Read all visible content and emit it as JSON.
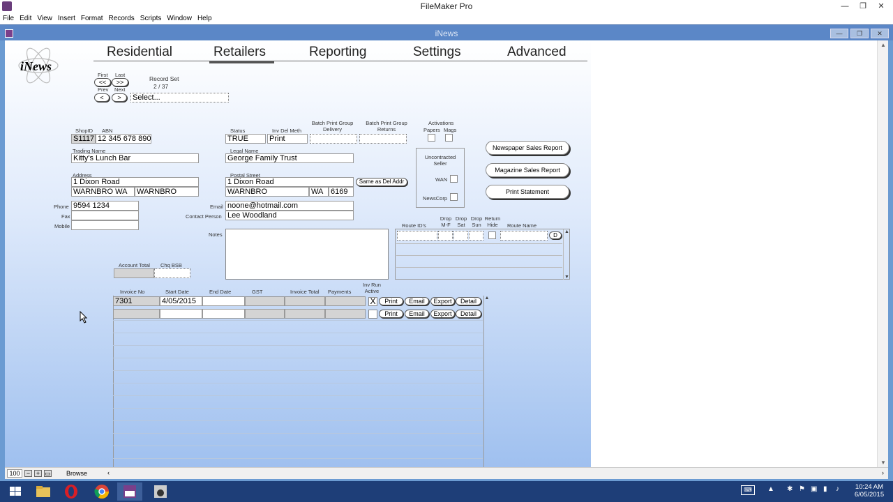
{
  "app": {
    "title": "FileMaker Pro",
    "doc_title": "iNews"
  },
  "menu": [
    "File",
    "Edit",
    "View",
    "Insert",
    "Format",
    "Records",
    "Scripts",
    "Window",
    "Help"
  ],
  "logo": "iNews",
  "nav_tabs": [
    "Residential",
    "Retailers",
    "Reporting",
    "Settings",
    "Advanced"
  ],
  "record_nav": {
    "first": "First",
    "last": "Last",
    "prev": "Prev",
    "next": "Next",
    "first_btn": "<<",
    "last_btn": ">>",
    "prev_btn": "<",
    "next_btn": ">",
    "record_set_label": "Record Set",
    "record_count": "2 / 37",
    "select_value": "Select..."
  },
  "labels": {
    "shopid": "ShopID",
    "abn": "ABN",
    "status": "Status",
    "inv_del_meth": "Inv Del Meth",
    "batch_delivery": "Batch Print Group Delivery",
    "batch_returns": "Batch Print Group Returns",
    "activations": "Activations",
    "papers": "Papers",
    "mags": "Mags",
    "trading_name": "Trading Name",
    "legal_name": "Legal Name",
    "address": "Address",
    "postal_street": "Postal Street",
    "phone": "Phone",
    "fax": "Fax",
    "mobile": "Mobile",
    "email": "Email",
    "contact_person": "Contact Person",
    "notes": "Notes",
    "account_total": "Account Total",
    "chq_bsb": "Chq BSB",
    "uncontracted": "Uncontracted Seller",
    "wan": "WAN",
    "newscorp": "NewsCorp",
    "route_ids": "Route ID's",
    "drop_mf": "Drop M-F",
    "drop_sat": "Drop Sat",
    "drop_sun": "Drop Sun",
    "return_hide": "Return Hide",
    "route_name": "Route Name"
  },
  "fields": {
    "shopid": "S1117",
    "abn": "12 345 678 890",
    "status": "TRUE",
    "inv_del_meth": "Print",
    "trading_name": "Kitty's Lunch Bar",
    "legal_name": "George Family Trust",
    "address1": "1 Dixon Road",
    "address_suburb": "WARNBRO WA",
    "address_town": "WARNBRO",
    "postal1": "1 Dixon Road",
    "postal_suburb": "WARNBRO",
    "postal_state": "WA",
    "postal_pc": "6169",
    "phone": "9594 1234",
    "email": "noone@hotmail.com",
    "contact_person": "Lee Woodland"
  },
  "buttons": {
    "same_as_del": "Same as Del Addr",
    "newspaper_report": "Newspaper Sales Report",
    "magazine_report": "Magazine Sales Report",
    "print_statement": "Print Statement",
    "route_d": "D"
  },
  "invoice": {
    "headers": [
      "Invoice No",
      "Start Date",
      "End Date",
      "GST",
      "Invoice Total",
      "Payments",
      "Inv Run Active"
    ],
    "rows": [
      {
        "invoice_no": "7301",
        "start_date": "4/05/2015",
        "active": "X"
      },
      {
        "invoice_no": "",
        "start_date": "",
        "active": ""
      }
    ],
    "actions": [
      "Print",
      "Email",
      "Export",
      "Detail"
    ]
  },
  "status_bar": {
    "zoom": "100",
    "mode": "Browse"
  },
  "clock": {
    "time": "10:24 AM",
    "date": "6/05/2015"
  }
}
